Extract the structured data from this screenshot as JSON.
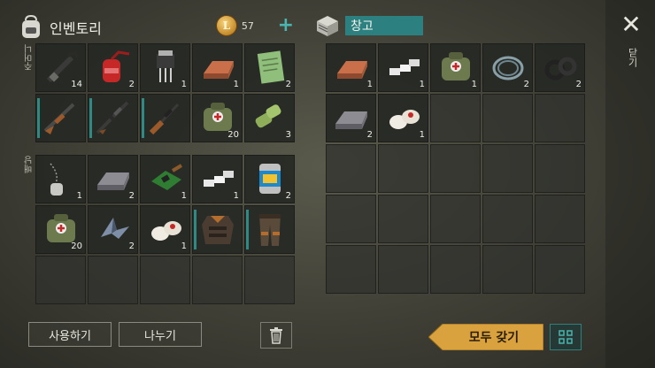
{
  "inventory": {
    "title": "인벤토리",
    "coins": "57",
    "add_label": "+",
    "section_pockets": "주머니",
    "section_backpack": "배낭",
    "pockets": [
      {
        "icon": "crowbar-icon",
        "qty": "14",
        "bar": false
      },
      {
        "icon": "gas-can-icon",
        "qty": "2",
        "bar": false
      },
      {
        "icon": "transistor-icon",
        "qty": "1",
        "bar": false
      },
      {
        "icon": "copper-ingot-icon",
        "qty": "1",
        "bar": false
      },
      {
        "icon": "notebook-icon",
        "qty": "2",
        "bar": false
      },
      {
        "icon": "shotgun-icon",
        "qty": "",
        "bar": true
      },
      {
        "icon": "assault-rifle-icon",
        "qty": "",
        "bar": true
      },
      {
        "icon": "hunting-rifle-icon",
        "qty": "",
        "bar": true
      },
      {
        "icon": "medkit-bag-icon",
        "qty": "20",
        "bar": false
      },
      {
        "icon": "ammo-cans-icon",
        "qty": "3",
        "bar": false
      }
    ],
    "backpack": [
      {
        "icon": "dog-tags-icon",
        "qty": "1",
        "bar": false
      },
      {
        "icon": "iron-ingot-icon",
        "qty": "2",
        "bar": false
      },
      {
        "icon": "circuit-board-icon",
        "qty": "1",
        "bar": false
      },
      {
        "icon": "aluminum-bars-icon",
        "qty": "1",
        "bar": false
      },
      {
        "icon": "food-can-icon",
        "qty": "2",
        "bar": false
      },
      {
        "icon": "medkit-bag-icon",
        "qty": "20",
        "bar": false
      },
      {
        "icon": "scrap-metal-icon",
        "qty": "2",
        "bar": false
      },
      {
        "icon": "bandage-icon",
        "qty": "1",
        "bar": false
      },
      {
        "icon": "armored-jacket-icon",
        "qty": "",
        "bar": true
      },
      {
        "icon": "armored-pants-icon",
        "qty": "",
        "bar": true
      }
    ],
    "use_label": "사용하기",
    "split_label": "나누기"
  },
  "storage": {
    "title": "창고",
    "items": [
      {
        "icon": "copper-ingot-icon",
        "qty": "1"
      },
      {
        "icon": "aluminum-bars-icon",
        "qty": "1"
      },
      {
        "icon": "medkit-bag-icon",
        "qty": "1"
      },
      {
        "icon": "wire-coil-icon",
        "qty": "2"
      },
      {
        "icon": "rubber-rings-icon",
        "qty": "2"
      },
      {
        "icon": "iron-ingot-icon",
        "qty": "2"
      },
      {
        "icon": "bandage-icon",
        "qty": "1"
      }
    ],
    "take_all_label": "모두 갖기"
  },
  "close_label": "닫기",
  "colors": {
    "accent": "#2c8080",
    "button_gold": "#e0a83a",
    "coin": "#d9a23f"
  }
}
